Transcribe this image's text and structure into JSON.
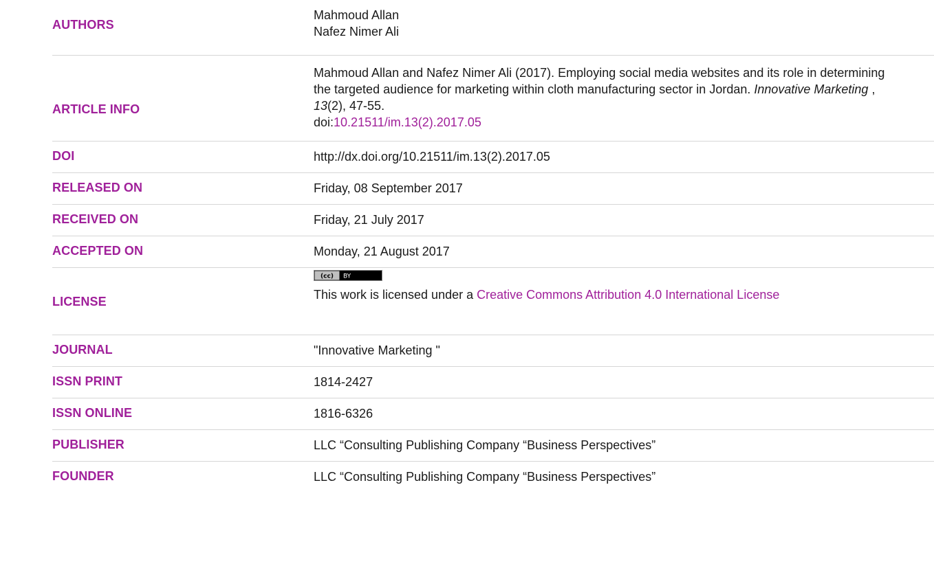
{
  "colors": {
    "accent": "#a0209a",
    "text": "#1a1a1a",
    "divider": "#d6d6d6"
  },
  "rows": {
    "authors": {
      "label": "AUTHORS",
      "values": [
        "Mahmoud Allan",
        "Nafez Nimer Ali"
      ]
    },
    "article_info": {
      "label": "ARTICLE INFO",
      "text_1": "Mahmoud Allan and Nafez Nimer Ali (2017). Employing social media websites and its role in determining the targeted audience for marketing within cloth manufacturing sector in Jordan. ",
      "journal_italic": "Innovative Marketing",
      "text_2": " , ",
      "volume_italic": "13",
      "text_3": "(2), 47-55.",
      "doi_prefix": "doi:",
      "doi_link": "10.21511/im.13(2).2017.05"
    },
    "doi": {
      "label": "DOI",
      "value": "http://dx.doi.org/10.21511/im.13(2).2017.05"
    },
    "released_on": {
      "label": "RELEASED ON",
      "value": "Friday, 08 September 2017"
    },
    "received_on": {
      "label": "RECEIVED ON",
      "value": "Friday, 21 July 2017"
    },
    "accepted_on": {
      "label": "ACCEPTED ON",
      "value": "Monday, 21 August 2017"
    },
    "license": {
      "label": "LICENSE",
      "badge_cc": "(cc)",
      "badge_by": "BY",
      "text_prefix": "This work is licensed under a ",
      "link_text": "Creative Commons Attribution 4.0 International License"
    },
    "journal": {
      "label": "JOURNAL",
      "value": "\"Innovative Marketing \""
    },
    "issn_print": {
      "label": "ISSN PRINT",
      "value": "1814-2427"
    },
    "issn_online": {
      "label": "ISSN ONLINE",
      "value": "1816-6326"
    },
    "publisher": {
      "label": "PUBLISHER",
      "value": "LLC “Consulting Publishing Company “Business Perspectives”"
    },
    "founder": {
      "label": "FOUNDER",
      "value": "LLC “Consulting Publishing Company “Business Perspectives”"
    }
  }
}
